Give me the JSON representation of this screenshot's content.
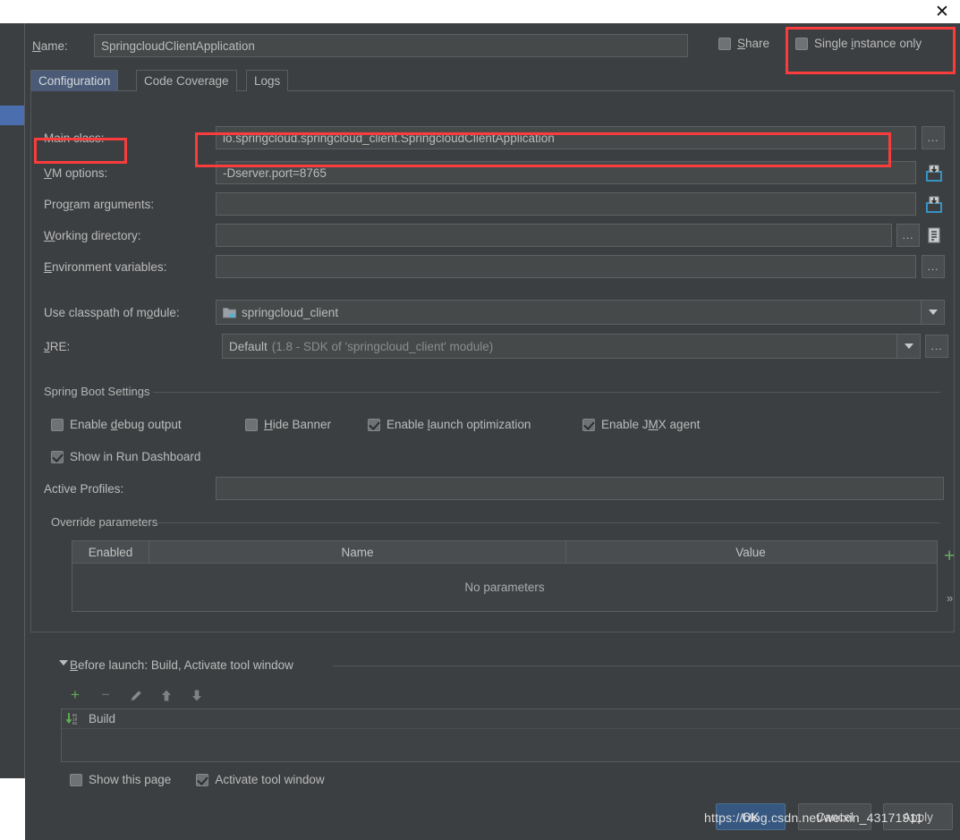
{
  "window": {
    "close_icon": "close-icon"
  },
  "header": {
    "name_label": "Name:",
    "name_value": "SpringcloudClientApplication",
    "share_label": "Share",
    "share_checked": false,
    "single_instance_label": "Single instance only",
    "single_instance_checked": false
  },
  "tabs": [
    {
      "label": "Configuration",
      "active": true
    },
    {
      "label": "Code Coverage",
      "active": false
    },
    {
      "label": "Logs",
      "active": false
    }
  ],
  "fields": {
    "main_class": {
      "label": "Main class:",
      "value": "io.springcloud.springcloud_client.SpringcloudClientApplication",
      "browse_label": "..."
    },
    "vm_options": {
      "label": "VM options:",
      "value": "-Dserver.port=8765",
      "placeholder": "",
      "expand_icon": "expand-editor-icon"
    },
    "program_arguments": {
      "label": "Program arguments:",
      "value": "",
      "expand_icon": "expand-editor-icon"
    },
    "working_directory": {
      "label": "Working directory:",
      "value": "",
      "browse_label": "...",
      "macro_icon": "insert-macro-icon"
    },
    "environment_variables": {
      "label": "Environment variables:",
      "value": "",
      "browse_label": "..."
    },
    "module": {
      "label": "Use classpath of module:",
      "value": "springcloud_client",
      "icon": "module-folder-icon"
    },
    "jre": {
      "label": "JRE:",
      "value": "Default",
      "value_detail": "(1.8 - SDK of 'springcloud_client' module)",
      "browse_label": "..."
    }
  },
  "spring_boot_settings": {
    "group_title": "Spring Boot Settings",
    "checkboxes": [
      {
        "label": "Enable debug output",
        "checked": false
      },
      {
        "label": "Hide Banner",
        "checked": false
      },
      {
        "label": "Enable launch optimization",
        "checked": true
      },
      {
        "label": "Enable JMX agent",
        "checked": true
      },
      {
        "label": "Show in Run Dashboard",
        "checked": true
      }
    ],
    "active_profiles": {
      "label": "Active Profiles:",
      "value": ""
    }
  },
  "override_parameters": {
    "group_title": "Override parameters",
    "columns": [
      "Enabled",
      "Name",
      "Value"
    ],
    "rows": [],
    "empty_text": "No parameters",
    "add_label": "+",
    "expand_label": "»"
  },
  "before_launch": {
    "title": "Before launch: Build, Activate tool window",
    "toolbar": [
      {
        "name": "add-button",
        "glyph": "+"
      },
      {
        "name": "remove-button",
        "glyph": "−"
      },
      {
        "name": "edit-button",
        "glyph": "✎"
      },
      {
        "name": "move-up-button",
        "glyph": "↑"
      },
      {
        "name": "move-down-button",
        "glyph": "↓"
      }
    ],
    "items": [
      {
        "label": "Build",
        "icon": "build-icon"
      }
    ],
    "checkboxes": [
      {
        "label": "Show this page",
        "checked": false
      },
      {
        "label": "Activate tool window",
        "checked": true
      }
    ]
  },
  "buttons": {
    "ok": "OK",
    "cancel": "Cancel",
    "apply": "Apply"
  },
  "watermark": "https://blog.csdn.net/weixin_43171911",
  "colors": {
    "panel_bg": "#3c3f41",
    "field_bg": "#45494a",
    "accent_blue": "#4b6eaf",
    "tab_active": "#4b5b77",
    "highlight_red": "#fa3c3c",
    "green": "#6aaa64",
    "text": "#bbbbbb"
  }
}
